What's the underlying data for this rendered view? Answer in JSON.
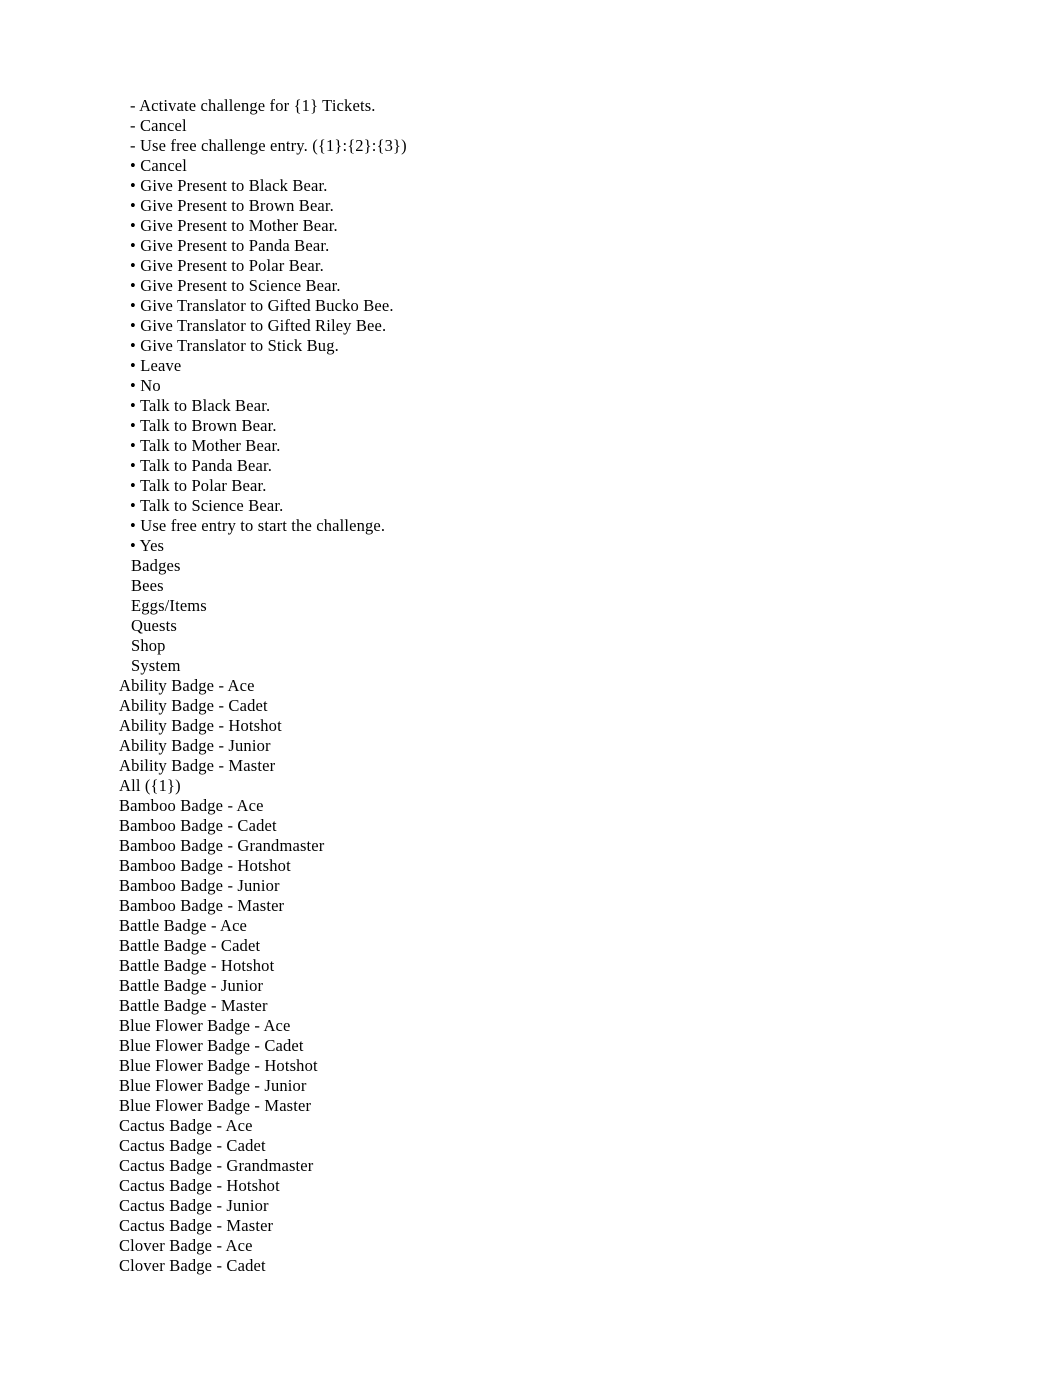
{
  "document": {
    "background_color": "#ffffff",
    "text_color": "#000000",
    "lines": [
      {
        "marker": "-",
        "text": "Activate challenge for {1} Tickets.",
        "group": "dash"
      },
      {
        "marker": "-",
        "text": "Cancel",
        "group": "dash"
      },
      {
        "marker": "-",
        "text": "Use free challenge entry. ({1}:{2}:{3})",
        "group": "dash"
      },
      {
        "marker": "•",
        "text": "Cancel",
        "group": "bullet"
      },
      {
        "marker": "•",
        "text": "Give Present to Black Bear.",
        "group": "bullet"
      },
      {
        "marker": "•",
        "text": "Give Present to Brown Bear.",
        "group": "bullet"
      },
      {
        "marker": "•",
        "text": "Give Present to Mother Bear.",
        "group": "bullet"
      },
      {
        "marker": "•",
        "text": "Give Present to Panda Bear.",
        "group": "bullet"
      },
      {
        "marker": "•",
        "text": "Give Present to Polar Bear.",
        "group": "bullet"
      },
      {
        "marker": "•",
        "text": "Give Present to Science Bear.",
        "group": "bullet"
      },
      {
        "marker": "•",
        "text": "Give Translator to Gifted Bucko Bee.",
        "group": "bullet"
      },
      {
        "marker": "•",
        "text": "Give Translator to Gifted Riley Bee.",
        "group": "bullet"
      },
      {
        "marker": "•",
        "text": "Give Translator to Stick Bug.",
        "group": "bullet"
      },
      {
        "marker": "•",
        "text": "Leave",
        "group": "bullet"
      },
      {
        "marker": "•",
        "text": "No",
        "group": "bullet"
      },
      {
        "marker": "•",
        "text": "Talk to Black Bear.",
        "group": "bullet"
      },
      {
        "marker": "•",
        "text": "Talk to Brown Bear.",
        "group": "bullet"
      },
      {
        "marker": "•",
        "text": "Talk to Mother Bear.",
        "group": "bullet"
      },
      {
        "marker": "•",
        "text": "Talk to Panda Bear.",
        "group": "bullet"
      },
      {
        "marker": "•",
        "text": "Talk to Polar Bear.",
        "group": "bullet"
      },
      {
        "marker": "•",
        "text": "Talk to Science Bear.",
        "group": "bullet"
      },
      {
        "marker": "•",
        "text": "Use free entry to start the challenge.",
        "group": "bullet"
      },
      {
        "marker": "•",
        "text": "Yes",
        "group": "bullet"
      },
      {
        "marker": "",
        "text": "Badges",
        "group": "category"
      },
      {
        "marker": "",
        "text": "Bees",
        "group": "category"
      },
      {
        "marker": "",
        "text": "Eggs/Items",
        "group": "category"
      },
      {
        "marker": "",
        "text": "Quests",
        "group": "category"
      },
      {
        "marker": "",
        "text": "Shop",
        "group": "category"
      },
      {
        "marker": "",
        "text": "System",
        "group": "category"
      },
      {
        "marker": "",
        "text": "Ability Badge - Ace",
        "group": "badge"
      },
      {
        "marker": "",
        "text": "Ability Badge - Cadet",
        "group": "badge"
      },
      {
        "marker": "",
        "text": "Ability Badge - Hotshot",
        "group": "badge"
      },
      {
        "marker": "",
        "text": "Ability Badge - Junior",
        "group": "badge"
      },
      {
        "marker": "",
        "text": "Ability Badge - Master",
        "group": "badge"
      },
      {
        "marker": "",
        "text": "All ({1})",
        "group": "badge"
      },
      {
        "marker": "",
        "text": "Bamboo Badge - Ace",
        "group": "badge"
      },
      {
        "marker": "",
        "text": "Bamboo Badge - Cadet",
        "group": "badge"
      },
      {
        "marker": "",
        "text": "Bamboo Badge - Grandmaster",
        "group": "badge"
      },
      {
        "marker": "",
        "text": "Bamboo Badge - Hotshot",
        "group": "badge"
      },
      {
        "marker": "",
        "text": "Bamboo Badge - Junior",
        "group": "badge"
      },
      {
        "marker": "",
        "text": "Bamboo Badge - Master",
        "group": "badge"
      },
      {
        "marker": "",
        "text": "Battle Badge - Ace",
        "group": "badge"
      },
      {
        "marker": "",
        "text": "Battle Badge - Cadet",
        "group": "badge"
      },
      {
        "marker": "",
        "text": "Battle Badge - Hotshot",
        "group": "badge"
      },
      {
        "marker": "",
        "text": "Battle Badge - Junior",
        "group": "badge"
      },
      {
        "marker": "",
        "text": "Battle Badge - Master",
        "group": "badge"
      },
      {
        "marker": "",
        "text": "Blue Flower Badge - Ace",
        "group": "badge"
      },
      {
        "marker": "",
        "text": "Blue Flower Badge - Cadet",
        "group": "badge"
      },
      {
        "marker": "",
        "text": "Blue Flower Badge - Hotshot",
        "group": "badge"
      },
      {
        "marker": "",
        "text": "Blue Flower Badge - Junior",
        "group": "badge"
      },
      {
        "marker": "",
        "text": "Blue Flower Badge - Master",
        "group": "badge"
      },
      {
        "marker": "",
        "text": "Cactus Badge - Ace",
        "group": "badge"
      },
      {
        "marker": "",
        "text": "Cactus Badge - Cadet",
        "group": "badge"
      },
      {
        "marker": "",
        "text": "Cactus Badge - Grandmaster",
        "group": "badge"
      },
      {
        "marker": "",
        "text": "Cactus Badge - Hotshot",
        "group": "badge"
      },
      {
        "marker": "",
        "text": "Cactus Badge - Junior",
        "group": "badge"
      },
      {
        "marker": "",
        "text": "Cactus Badge - Master",
        "group": "badge"
      },
      {
        "marker": "",
        "text": "Clover Badge - Ace",
        "group": "badge"
      },
      {
        "marker": "",
        "text": "Clover Badge - Cadet",
        "group": "badge"
      }
    ]
  }
}
